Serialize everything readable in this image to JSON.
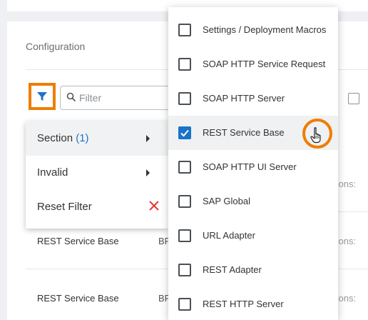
{
  "panel": {
    "title": "Configuration"
  },
  "search": {
    "placeholder": "Filter",
    "value": ""
  },
  "filter_menu": {
    "items": [
      {
        "label": "Section",
        "count": "(1)"
      },
      {
        "label": "Invalid"
      },
      {
        "label": "Reset Filter"
      }
    ]
  },
  "section_options": [
    {
      "label": "Settings / Deployment Macros",
      "checked": false
    },
    {
      "label": "SOAP HTTP Service Request",
      "checked": false
    },
    {
      "label": "SOAP HTTP Server",
      "checked": false
    },
    {
      "label": "REST Service Base",
      "checked": true
    },
    {
      "label": "SOAP HTTP UI Server",
      "checked": false
    },
    {
      "label": "SAP Global",
      "checked": false
    },
    {
      "label": "URL Adapter",
      "checked": false
    },
    {
      "label": "REST Adapter",
      "checked": false
    },
    {
      "label": "REST HTTP Server",
      "checked": false
    }
  ],
  "table": {
    "rows": [
      {
        "section": "",
        "col2": "",
        "col3": "tions:"
      },
      {
        "section": "REST Service Base",
        "col2": "BF",
        "col3": "tions:"
      },
      {
        "section": "REST Service Base",
        "col2": "BF",
        "col3": "tions:"
      }
    ]
  },
  "colors": {
    "accent": "#ef7d00",
    "primary": "#1a73c8",
    "reset": "#e53935"
  },
  "icons": [
    "filter-icon",
    "search-icon",
    "chevron-right-icon",
    "close-icon",
    "checkmark-icon",
    "hand-cursor-icon"
  ]
}
